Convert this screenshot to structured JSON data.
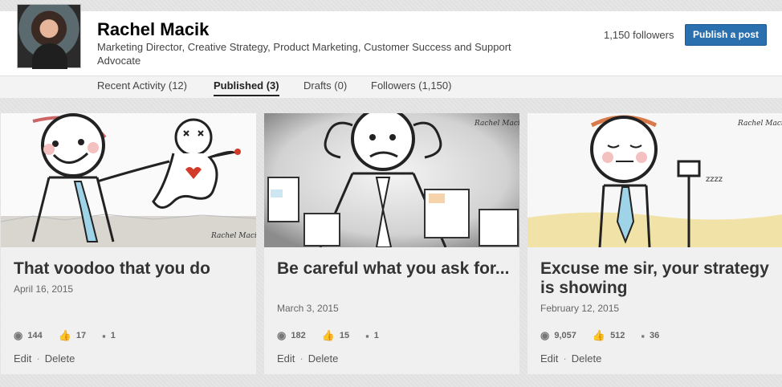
{
  "profile": {
    "name": "Rachel Macik",
    "headline": "Marketing Director, Creative Strategy, Product Marketing, Customer Success and Support Advocate",
    "followers": "1,150 followers",
    "publish_label": "Publish a post"
  },
  "tabs": [
    {
      "label": "Recent Activity (12)"
    },
    {
      "label": "Published (3)"
    },
    {
      "label": "Drafts (0)"
    },
    {
      "label": "Followers (1,150)"
    }
  ],
  "posts": [
    {
      "title": "That voodoo that you do",
      "date": "April 16, 2015",
      "views": "144",
      "likes": "17",
      "comments": "1"
    },
    {
      "title": "Be careful what you ask for...",
      "date": "March 3, 2015",
      "views": "182",
      "likes": "15",
      "comments": "1"
    },
    {
      "title": "Excuse me sir, your strategy is showing",
      "date": "February 12, 2015",
      "views": "9,057",
      "likes": "512",
      "comments": "36"
    }
  ],
  "actions": {
    "edit": "Edit",
    "delete": "Delete"
  },
  "signature": "Rachel Macik",
  "snore": "zzzz",
  "accent": "#2a6fae",
  "icons": {
    "views": "eye-icon",
    "likes": "thumbs-up-icon",
    "comments": "comment-icon"
  }
}
